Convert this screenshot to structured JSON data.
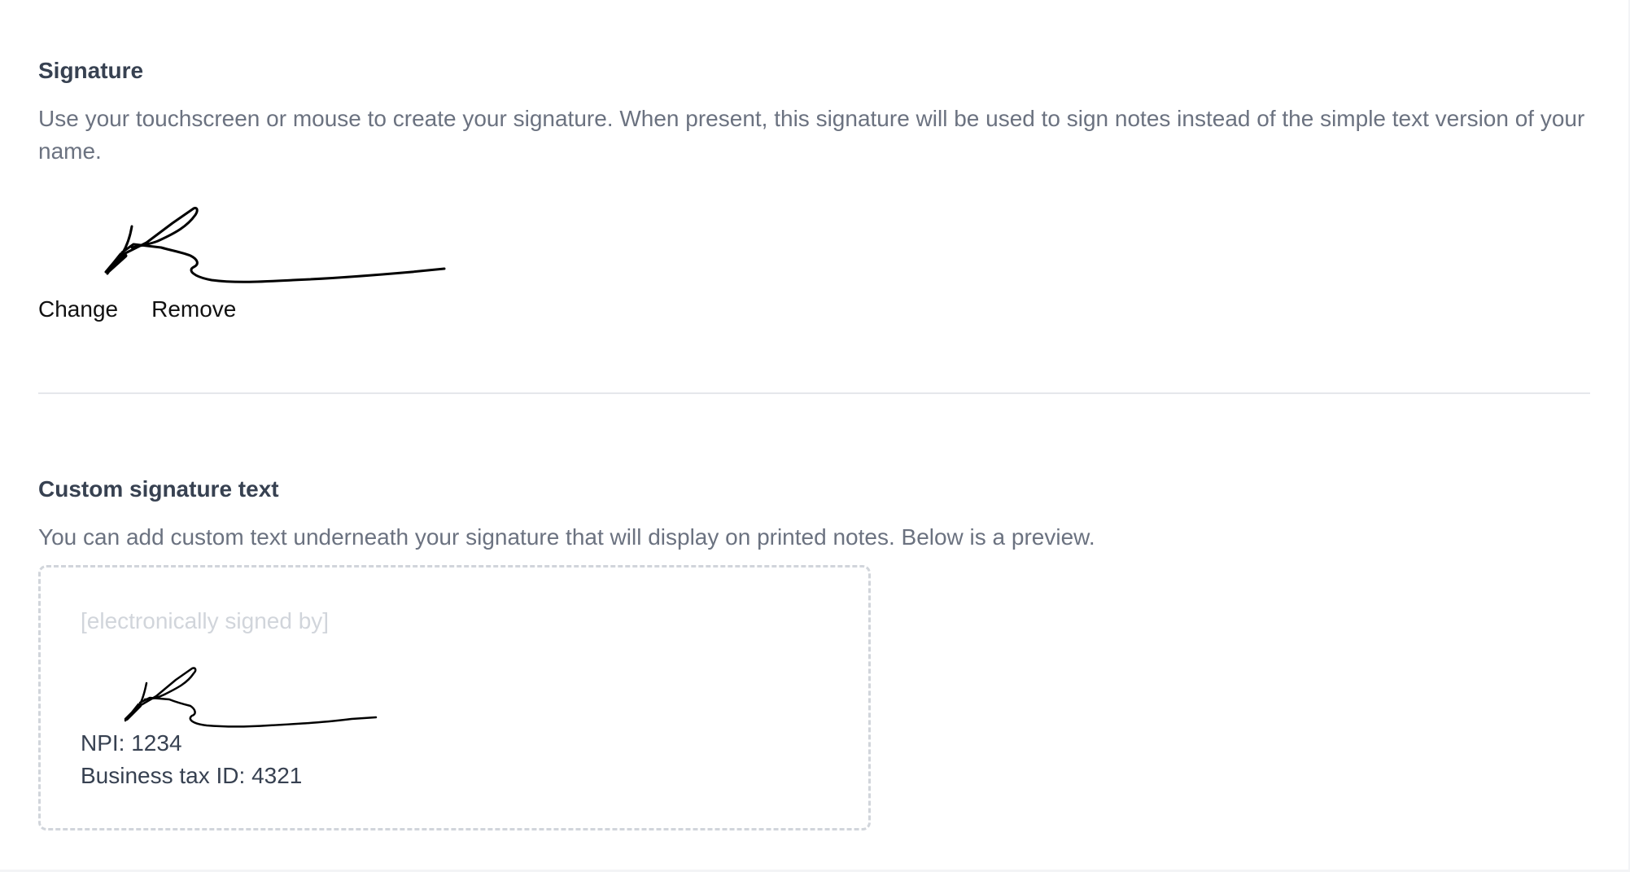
{
  "signature_section": {
    "title": "Signature",
    "description": "Use your touchscreen or mouse to create your signature. When present, this signature will be used to sign notes instead of the simple text version of your name.",
    "change_label": "Change",
    "remove_label": "Remove"
  },
  "custom_section": {
    "title": "Custom signature text",
    "description": "You can add custom text underneath your signature that will display on printed notes. Below is a preview.",
    "preview": {
      "placeholder": "[electronically signed by]",
      "lines": [
        "NPI: 1234",
        "Business tax ID: 4321"
      ]
    }
  }
}
